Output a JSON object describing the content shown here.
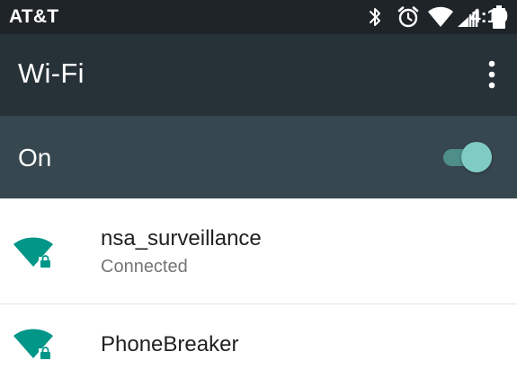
{
  "status_bar": {
    "carrier": "AT&T",
    "time": "4:19",
    "icons": [
      "bluetooth-icon",
      "alarm-icon",
      "wifi-signal-icon",
      "cell-signal-icon",
      "battery-icon"
    ]
  },
  "app_bar": {
    "title": "Wi-Fi",
    "overflow_icon": "more-vert-icon"
  },
  "master_switch": {
    "label": "On",
    "state": true
  },
  "networks": [
    {
      "ssid": "nsa_surveillance",
      "status": "Connected",
      "secured": true,
      "signal_icon": "wifi-lock-icon"
    },
    {
      "ssid": "PhoneBreaker",
      "secured": true,
      "signal_icon": "wifi-lock-icon"
    }
  ],
  "colors": {
    "status_bar_bg": "#1e2427",
    "app_bar_bg": "#263238",
    "switch_bar_bg": "#37474f",
    "accent": "#009688",
    "toggle_thumb": "#80cbc4",
    "primary_text": "#212121",
    "secondary_text": "#757575"
  }
}
